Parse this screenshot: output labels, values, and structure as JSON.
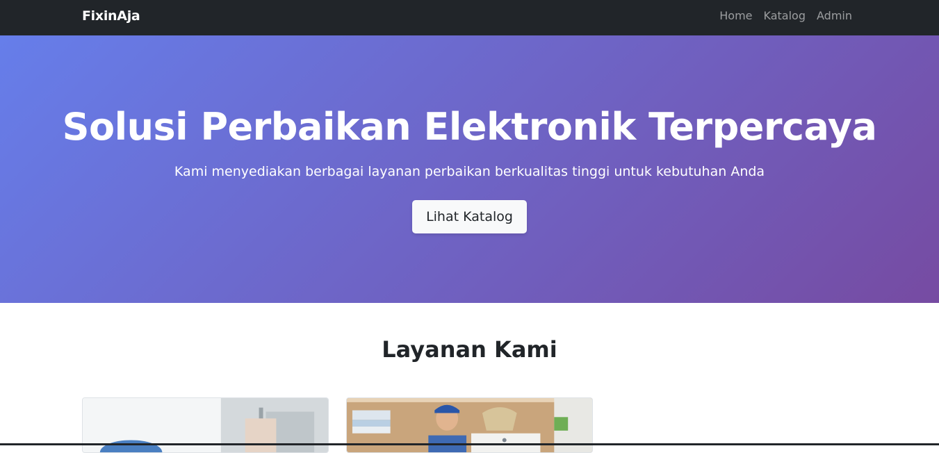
{
  "navbar": {
    "brand": "FixinAja",
    "links": [
      {
        "label": "Home"
      },
      {
        "label": "Katalog"
      },
      {
        "label": "Admin"
      }
    ]
  },
  "hero": {
    "title": "Solusi Perbaikan Elektronik Terpercaya",
    "subtitle": "Kami menyediakan berbagai layanan perbaikan berkualitas tinggi untuk kebutuhan Anda",
    "button_label": "Lihat Katalog",
    "gradient_start": "#667eea",
    "gradient_end": "#764ba2"
  },
  "services": {
    "title": "Layanan Kami",
    "cards": [
      {
        "image": "ac-repair-photo"
      },
      {
        "image": "washing-machine-technician-photo"
      }
    ]
  },
  "colors": {
    "navbar_bg": "#212529",
    "text_dark": "#212529",
    "button_bg": "#f8f9fa"
  }
}
